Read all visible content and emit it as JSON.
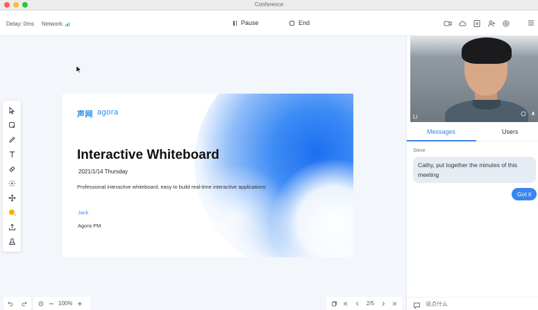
{
  "window": {
    "title": "Conference"
  },
  "toolbar": {
    "delay": "Delay: 0ms",
    "network_label": "Network:",
    "pause_label": "Pause",
    "end_label": "End",
    "icons": [
      "camera-icon",
      "cloud-icon",
      "document-icon",
      "add-user-icon",
      "settings-icon",
      "menu-icon"
    ]
  },
  "whiteboard": {
    "tools": [
      "select-icon",
      "selector-icon",
      "pencil-icon",
      "text-icon",
      "eraser-icon",
      "laser-pointer-icon",
      "move-icon",
      "color-picker-icon",
      "upload-icon",
      "toolbox-icon"
    ],
    "tool_color": "#f2b705",
    "slide": {
      "logo_cn": "声网",
      "logo_en": "agora",
      "title": "Interactive Whiteboard",
      "date": "2021/1/14 Thursday",
      "description": "Professional interactive whiteboard, easy to build real-time interactive applications",
      "author": "Jack",
      "role": "Agora PM"
    },
    "zoom": "100%",
    "page": {
      "current": 2,
      "total": 5,
      "label": "2/5"
    }
  },
  "panel": {
    "video": {
      "name": "Li"
    },
    "tabs": [
      {
        "label": "Messages",
        "active": true
      },
      {
        "label": "Users",
        "active": false
      }
    ],
    "messages": [
      {
        "sender": "Steve",
        "text": "Cathy, put together the minutes of this meeting",
        "direction": "in"
      },
      {
        "sender": "",
        "text": "Got it",
        "direction": "out"
      }
    ],
    "input": {
      "placeholder": "说点什么"
    }
  },
  "colors": {
    "accent": "#3a7fe6",
    "bubble_out": "#3a86f0",
    "bubble_in": "#e6ecf4"
  }
}
